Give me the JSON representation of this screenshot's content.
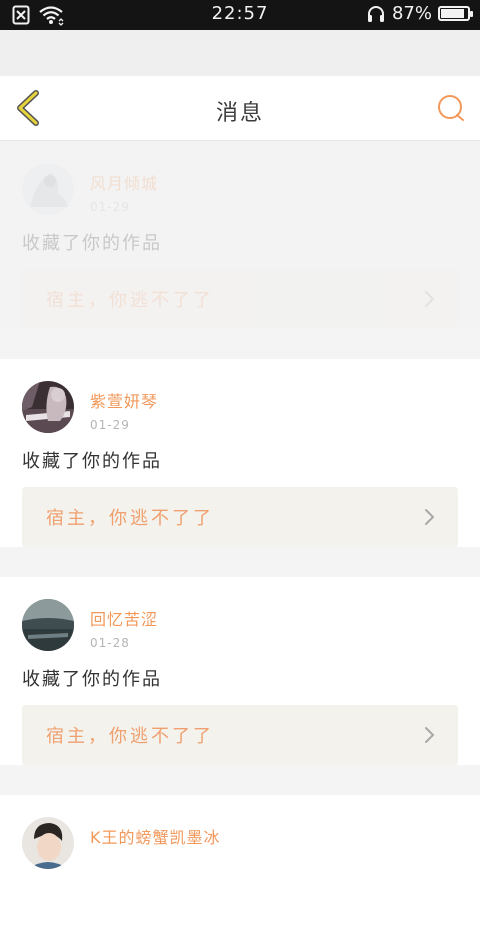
{
  "status_bar": {
    "time": "22:57",
    "battery_percent": "87%",
    "battery_level": 0.87
  },
  "header": {
    "title": "消息",
    "back_icon": "chevron-left-icon",
    "search_icon": "search-icon"
  },
  "colors": {
    "accent_orange": "#f2985a",
    "back_icon_yellow": "#e4d33a"
  },
  "messages": [
    {
      "user_name": "风月倾城",
      "date": "01-29",
      "action": "收藏了你的作品",
      "work_title": "宿主，你逃不了了",
      "faded": true
    },
    {
      "user_name": "紫萱妍琴",
      "date": "01-29",
      "action": "收藏了你的作品",
      "work_title": "宿主，你逃不了了",
      "faded": false
    },
    {
      "user_name": "回忆苦涩",
      "date": "01-28",
      "action": "收藏了你的作品",
      "work_title": "宿主，你逃不了了",
      "faded": false
    },
    {
      "user_name": "K王的螃蟹凯墨冰",
      "date": "",
      "action": "",
      "work_title": "",
      "faded": false
    }
  ]
}
